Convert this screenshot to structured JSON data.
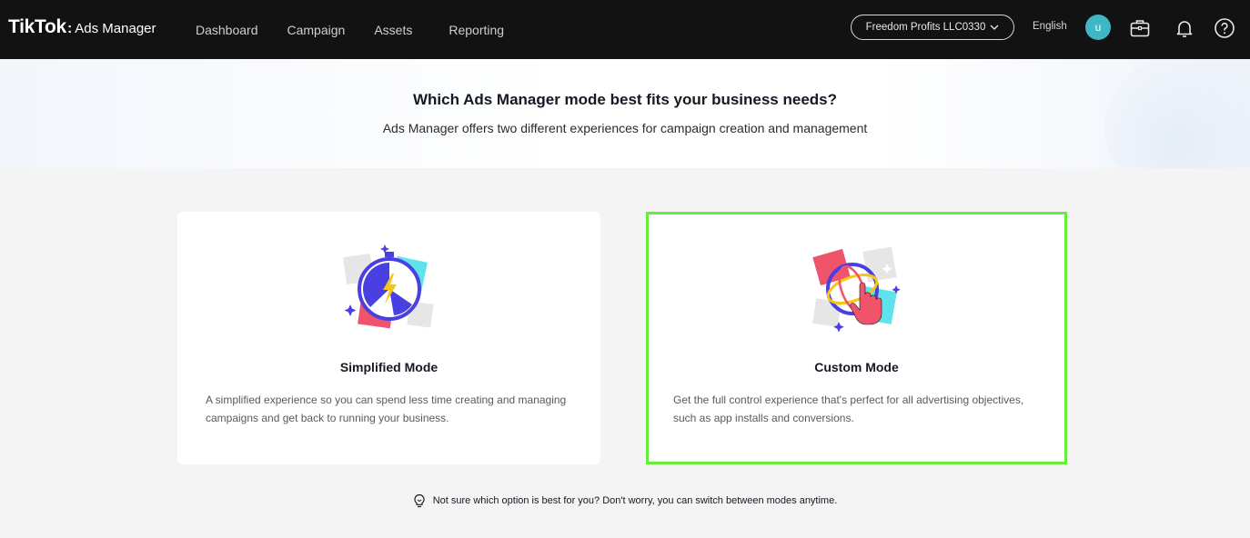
{
  "header": {
    "brand": "TikTok",
    "brand_suffix": "Ads Manager",
    "nav": [
      "Dashboard",
      "Campaign",
      "Assets",
      "Reporting"
    ],
    "account": "Freedom Profits LLC0330",
    "language": "English",
    "avatar_initial": "u",
    "icons": [
      "briefcase-icon",
      "bell-icon",
      "help-icon"
    ]
  },
  "hero": {
    "title": "Which Ads Manager mode best fits your business needs?",
    "subtitle": "Ads Manager offers two different experiences for campaign creation and management"
  },
  "modes": [
    {
      "title": "Simplified Mode",
      "description": "A simplified experience so you can spend less time creating and managing campaigns and get back to running your business.",
      "selected": false
    },
    {
      "title": "Custom Mode",
      "description": "Get the full control experience that's perfect for all advertising objectives, such as app installs and conversions.",
      "selected": true
    }
  ],
  "tip": "Not sure which option is best for you? Don't worry, you can switch between modes anytime.",
  "colors": {
    "topbar": "#121212",
    "selection_border": "#66ee3a",
    "avatar": "#3fb7c6"
  }
}
